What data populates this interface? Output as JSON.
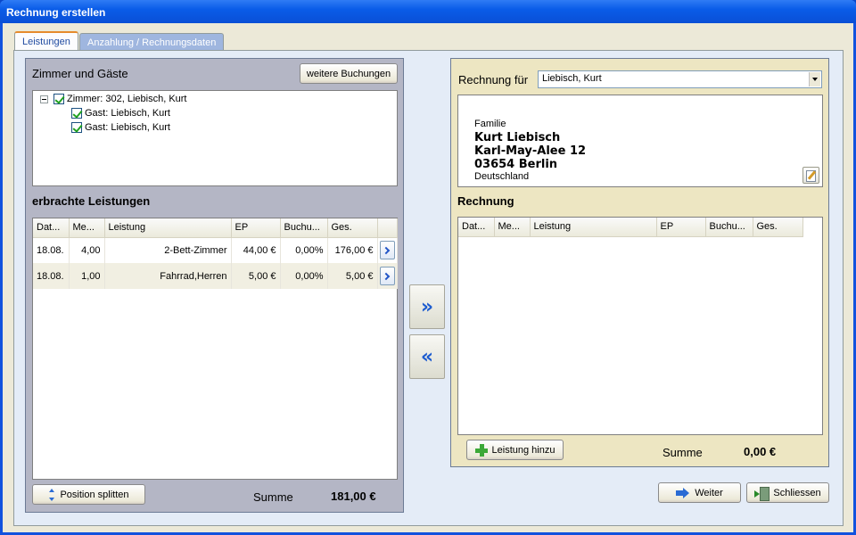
{
  "window": {
    "title": "Rechnung erstellen"
  },
  "tabs": [
    {
      "label": "Leistungen",
      "active": true
    },
    {
      "label": "Anzahlung / Rechnungsdaten",
      "active": false
    }
  ],
  "left": {
    "rooms_label": "Zimmer und Gäste",
    "more_bookings_button": "weitere Buchungen",
    "tree": [
      {
        "label": "Zimmer: 302, Liebisch, Kurt",
        "checked": true,
        "level": 0
      },
      {
        "label": "Gast: Liebisch, Kurt",
        "checked": true,
        "level": 1
      },
      {
        "label": "Gast: Liebisch, Kurt",
        "checked": true,
        "level": 1
      }
    ],
    "services_label": "erbrachte Leistungen",
    "columns": [
      "Dat...",
      "Me...",
      "Leistung",
      "EP",
      "Buchu...",
      "Ges."
    ],
    "rows": [
      {
        "date": "18.08.",
        "qty": "4,00",
        "service": "2-Bett-Zimmer",
        "ep": "44,00 €",
        "booking": "0,00%",
        "total": "176,00 €"
      },
      {
        "date": "18.08.",
        "qty": "1,00",
        "service": "Fahrrad,Herren",
        "ep": "5,00 €",
        "booking": "0,00%",
        "total": "5,00 €"
      }
    ],
    "split_button": "Position splitten",
    "sum_label": "Summe",
    "sum_value": "181,00 €"
  },
  "middle": {
    "move_right": "»",
    "move_left": "«"
  },
  "right": {
    "invoice_for_label": "Rechnung für",
    "invoice_for_value": "Liebisch, Kurt",
    "address": {
      "salutation": "Familie",
      "name": "Kurt Liebisch",
      "street": "Karl-May-Alee 12",
      "city": "03654 Berlin",
      "country": "Deutschland"
    },
    "invoice_label": "Rechnung",
    "columns": [
      "Dat...",
      "Me...",
      "Leistung",
      "EP",
      "Buchu...",
      "Ges."
    ],
    "add_service_button": "Leistung hinzu",
    "sum_label": "Summe",
    "sum_value": "0,00 €"
  },
  "footer": {
    "next_button": "Weiter",
    "close_button": "Schliessen"
  },
  "colors": {
    "title_blue": "#0a5ce8",
    "panel_left": "#b4b6c5",
    "panel_right": "#ede6c2",
    "client_bg": "#ece9d8"
  }
}
